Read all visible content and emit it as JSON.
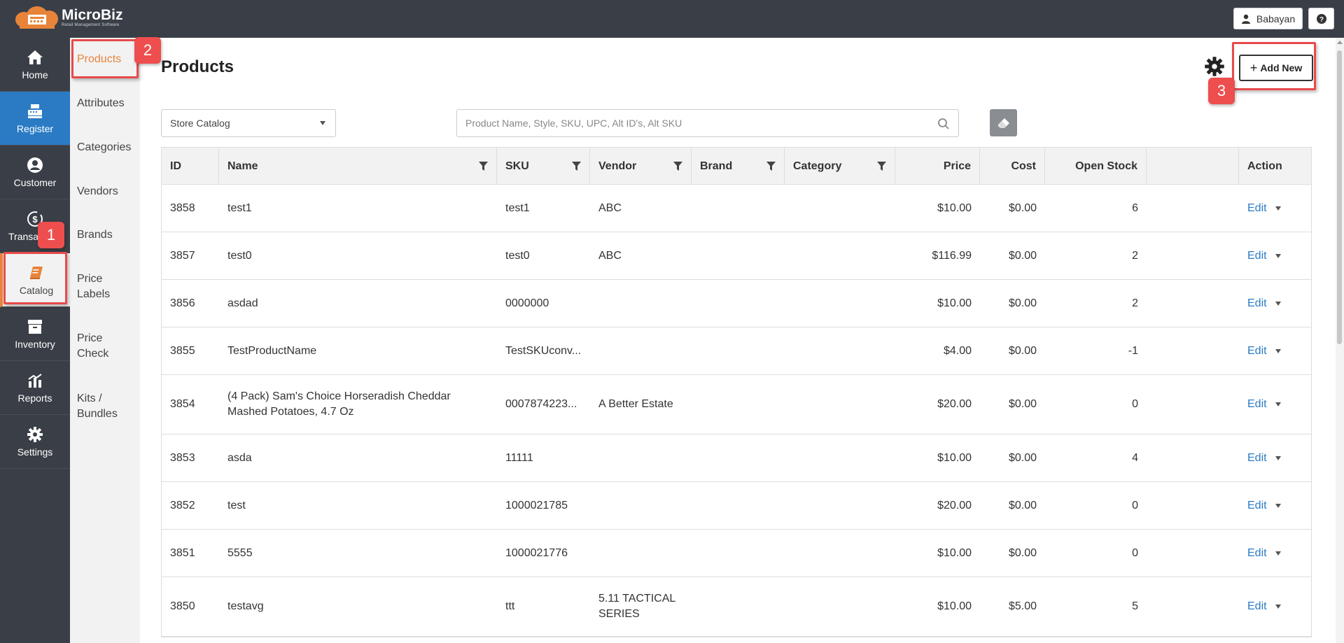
{
  "app": {
    "logo_name": "MicroBiz",
    "logo_tag": "Retail Management Software",
    "brand_color": "#e8843a"
  },
  "header": {
    "user_label": "Babayan",
    "user_icon": "user-icon",
    "help_icon": "question-icon"
  },
  "leftnav": {
    "items": [
      {
        "label": "Home",
        "icon": "home-icon"
      },
      {
        "label": "Register",
        "icon": "register-icon"
      },
      {
        "label": "Customer",
        "icon": "customer-icon"
      },
      {
        "label": "Transa",
        "icon": "transactions-icon"
      },
      {
        "label": "Catalog",
        "icon": "catalog-icon"
      },
      {
        "label": "Inventory",
        "icon": "inventory-icon"
      },
      {
        "label": "Reports",
        "icon": "reports-icon"
      },
      {
        "label": "Settings",
        "icon": "settings-icon"
      }
    ],
    "register_color": "#2a7bc4"
  },
  "subnav": {
    "items": [
      "Products",
      "Attributes",
      "Categories",
      "Vendors",
      "Brands",
      "Price Labels",
      "Price Check",
      "Kits / Bundles"
    ]
  },
  "annotations": [
    "1",
    "2",
    "3"
  ],
  "main": {
    "title": "Products",
    "add_label": "Add New",
    "catalog_select": "Store Catalog",
    "search_placeholder": "Product Name, Style, SKU, UPC, Alt ID's, Alt SKU"
  },
  "table": {
    "columns": [
      "ID",
      "Name",
      "SKU",
      "Vendor",
      "Brand",
      "Category",
      "Price",
      "Cost",
      "Open Stock",
      "",
      "Action"
    ],
    "action_label": "Edit",
    "rows": [
      {
        "id": "3858",
        "name": "test1",
        "sku": "test1",
        "vendor": "ABC",
        "brand": "",
        "category": "",
        "price": "$10.00",
        "cost": "$0.00",
        "stock": "6"
      },
      {
        "id": "3857",
        "name": "test0",
        "sku": "test0",
        "vendor": "ABC",
        "brand": "",
        "category": "",
        "price": "$116.99",
        "cost": "$0.00",
        "stock": "2"
      },
      {
        "id": "3856",
        "name": "asdad",
        "sku": "0000000",
        "vendor": "",
        "brand": "",
        "category": "",
        "price": "$10.00",
        "cost": "$0.00",
        "stock": "2"
      },
      {
        "id": "3855",
        "name": "TestProductName",
        "sku": "TestSKUconv...",
        "vendor": "",
        "brand": "",
        "category": "",
        "price": "$4.00",
        "cost": "$0.00",
        "stock": "-1"
      },
      {
        "id": "3854",
        "name": "(4 Pack) Sam's Choice Horseradish Cheddar Mashed Potatoes, 4.7 Oz",
        "sku": "0007874223...",
        "vendor": "A Better Estate",
        "brand": "",
        "category": "",
        "price": "$20.00",
        "cost": "$0.00",
        "stock": "0"
      },
      {
        "id": "3853",
        "name": "asda",
        "sku": "11111",
        "vendor": "",
        "brand": "",
        "category": "",
        "price": "$10.00",
        "cost": "$0.00",
        "stock": "4"
      },
      {
        "id": "3852",
        "name": "test",
        "sku": "1000021785",
        "vendor": "",
        "brand": "",
        "category": "",
        "price": "$20.00",
        "cost": "$0.00",
        "stock": "0"
      },
      {
        "id": "3851",
        "name": "5555",
        "sku": "1000021776",
        "vendor": "",
        "brand": "",
        "category": "",
        "price": "$10.00",
        "cost": "$0.00",
        "stock": "0"
      },
      {
        "id": "3850",
        "name": "testavg",
        "sku": "ttt",
        "vendor": "5.11 TACTICAL SERIES",
        "brand": "",
        "category": "",
        "price": "$10.00",
        "cost": "$5.00",
        "stock": "5"
      }
    ]
  }
}
